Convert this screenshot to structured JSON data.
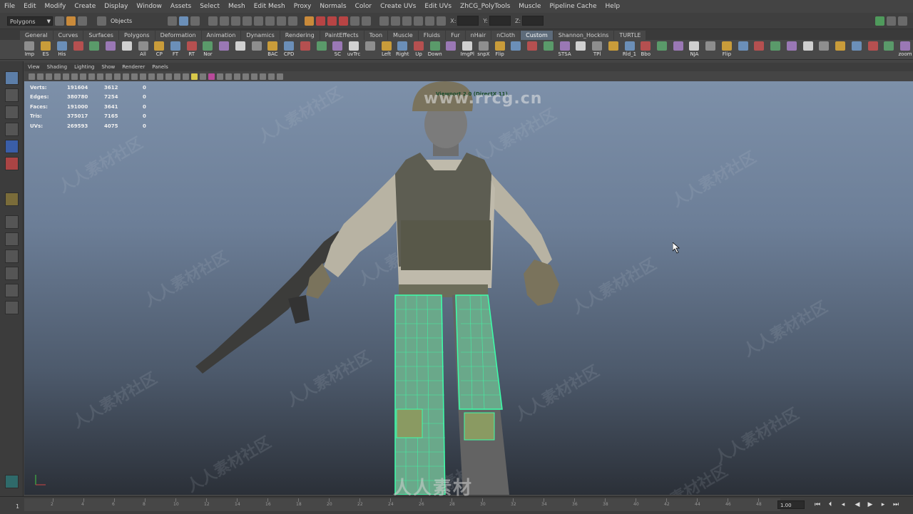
{
  "menus": [
    "File",
    "Edit",
    "Modify",
    "Create",
    "Display",
    "Window",
    "Assets",
    "Select",
    "Mesh",
    "Edit Mesh",
    "Proxy",
    "Normals",
    "Color",
    "Create UVs",
    "Edit UVs",
    "ZhCG_PolyTools",
    "Muscle",
    "Pipeline Cache",
    "Help"
  ],
  "status": {
    "mode": "Polygons",
    "selection_mask": "Objects",
    "coord_labels": [
      "X:",
      "Y:",
      "Z:"
    ]
  },
  "shelf_tabs": [
    "General",
    "Curves",
    "Surfaces",
    "Polygons",
    "Deformation",
    "Animation",
    "Dynamics",
    "Rendering",
    "PaintEffects",
    "Toon",
    "Muscle",
    "Fluids",
    "Fur",
    "nHair",
    "nCloth",
    "Custom",
    "Shannon_Hockins",
    "TURTLE"
  ],
  "active_shelf_tab": "Custom",
  "shelf_buttons": [
    "Imp",
    "ES",
    "His",
    "",
    "",
    "",
    "",
    "All",
    "CP",
    "FT",
    "RT",
    "Nor",
    "",
    "",
    "",
    "BAC",
    "CPD",
    "",
    "",
    "SC",
    "uvTrc",
    "",
    "Left",
    "Right",
    "Up",
    "Down",
    "",
    "ImgPl",
    "snpX",
    "Flip",
    "",
    "",
    "",
    "STSA",
    "",
    "TPl",
    "",
    "Rld_1",
    "Bbo",
    "",
    "",
    "NJA",
    "",
    "Flip",
    "",
    "",
    "",
    "",
    "",
    "",
    "",
    "",
    "",
    "",
    "zoom"
  ],
  "panel_menus": [
    "View",
    "Shading",
    "Lighting",
    "Show",
    "Renderer",
    "Panels"
  ],
  "hud": [
    {
      "label": "Verts:",
      "total": "191604",
      "selected": "3612",
      "tri": "0"
    },
    {
      "label": "Edges:",
      "total": "380780",
      "selected": "7254",
      "tri": "0"
    },
    {
      "label": "Faces:",
      "total": "191000",
      "selected": "3641",
      "tri": "0"
    },
    {
      "label": "Tris:",
      "total": "375017",
      "selected": "7165",
      "tri": "0"
    },
    {
      "label": "UVs:",
      "total": "269593",
      "selected": "4075",
      "tri": "0"
    }
  ],
  "viewport_title": "Viewport 2.0 (DirectX 11)",
  "timeline": {
    "start": "1",
    "current_frame": "1.00",
    "ticks": [
      "2",
      "4",
      "6",
      "8",
      "10",
      "12",
      "14",
      "16",
      "18",
      "20",
      "22",
      "24",
      "26",
      "28",
      "30",
      "32",
      "34",
      "36",
      "38",
      "40",
      "42",
      "44",
      "46",
      "48"
    ]
  },
  "watermarks": {
    "top_brand": "www.rrcg.cn",
    "bottom_logo": "人人素材",
    "tile_text": "人人素材社区"
  }
}
